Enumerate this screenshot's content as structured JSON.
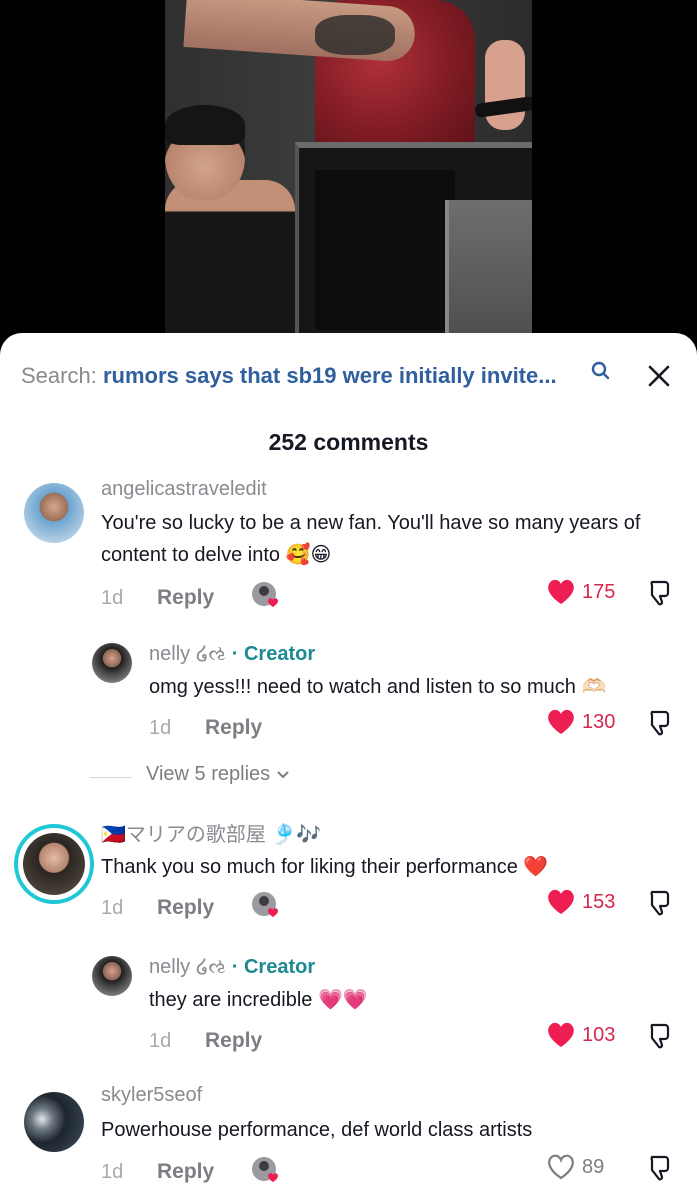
{
  "search": {
    "prefix": "Search:",
    "query": "rumors says that sb19 were initially invite..."
  },
  "comments_header": {
    "count_label": "252 comments"
  },
  "comments": [
    {
      "username": "angelicastraveledit",
      "text": "You're so lucky to be a new fan. You'll have so many years of content to delve into 🥰😁",
      "time": "1d",
      "reply_label": "Reply",
      "likes": "175",
      "liked": true
    },
    {
      "username": "nelly ໒ઌ",
      "creator_badge": "· Creator",
      "text": "omg yess!!! need to watch and listen to so much 🫶🏻",
      "time": "1d",
      "reply_label": "Reply",
      "likes": "130",
      "liked": true
    },
    {
      "username": "🇵🇭マリアの歌部屋 🎐🎶",
      "text": "Thank you so much for liking their performance ❤️",
      "time": "1d",
      "reply_label": "Reply",
      "likes": "153",
      "liked": true
    },
    {
      "username": "nelly ໒ઌ",
      "creator_badge": "· Creator",
      "text": "they are incredible 💗💗",
      "time": "1d",
      "reply_label": "Reply",
      "likes": "103",
      "liked": true
    },
    {
      "username": "skyler5seof",
      "text": "Powerhouse performance, def world class artists",
      "time": "1d",
      "reply_label": "Reply",
      "likes": "89",
      "liked": false
    }
  ],
  "view_replies": {
    "label": "View 5 replies"
  },
  "colors": {
    "liked_heart": "#ee1d52",
    "creator": "#1c8a92",
    "search_query": "#2f5f9e",
    "story_ring": "#20c7d6"
  },
  "icons": [
    "search-icon",
    "close-icon",
    "heart-icon",
    "dislike-icon",
    "chevron-down-icon",
    "liked-by-creator-icon"
  ]
}
